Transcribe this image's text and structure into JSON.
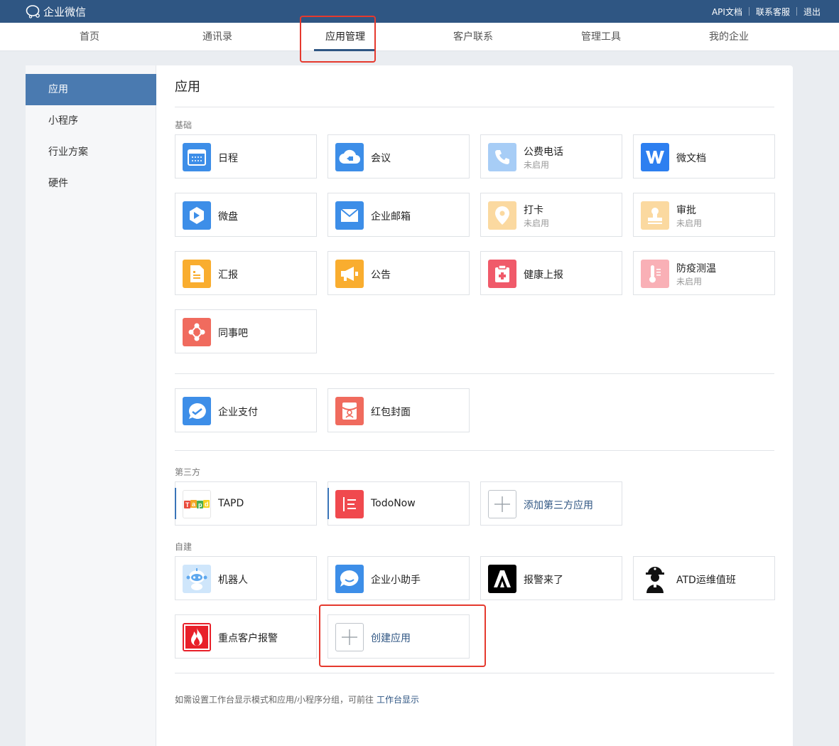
{
  "header": {
    "logo_text": "企业微信",
    "links": {
      "api": "API文档",
      "support": "联系客服",
      "logout": "退出"
    }
  },
  "nav": {
    "items": [
      "首页",
      "通讯录",
      "应用管理",
      "客户联系",
      "管理工具",
      "我的企业"
    ],
    "active_index": 2
  },
  "sidebar": {
    "items": [
      "应用",
      "小程序",
      "行业方案",
      "硬件"
    ],
    "active_index": 0
  },
  "main": {
    "title": "应用",
    "sections": {
      "basic": "基础",
      "third_party": "第三方",
      "custom": "自建"
    },
    "basic_apps": [
      {
        "name": "日程",
        "status": ""
      },
      {
        "name": "会议",
        "status": ""
      },
      {
        "name": "公费电话",
        "status": "未启用"
      },
      {
        "name": "微文档",
        "status": ""
      },
      {
        "name": "微盘",
        "status": ""
      },
      {
        "name": "企业邮箱",
        "status": ""
      },
      {
        "name": "打卡",
        "status": "未启用"
      },
      {
        "name": "审批",
        "status": "未启用"
      },
      {
        "name": "汇报",
        "status": ""
      },
      {
        "name": "公告",
        "status": ""
      },
      {
        "name": "健康上报",
        "status": ""
      },
      {
        "name": "防疫测温",
        "status": "未启用"
      },
      {
        "name": "同事吧",
        "status": ""
      }
    ],
    "payment_apps": [
      {
        "name": "企业支付"
      },
      {
        "name": "红包封面"
      }
    ],
    "third_party_apps": [
      {
        "name": "TAPD"
      },
      {
        "name": "TodoNow"
      }
    ],
    "add_third_party_label": "添加第三方应用",
    "custom_apps": [
      {
        "name": "机器人"
      },
      {
        "name": "企业小助手"
      },
      {
        "name": "报警来了"
      },
      {
        "name": "ATD运维值班"
      },
      {
        "name": "重点客户报警"
      }
    ],
    "create_app_label": "创建应用",
    "footer_note": "如需设置工作台显示模式和应用/小程序分组，可前往",
    "footer_link": "工作台显示"
  },
  "colors": {
    "header_bg": "#2f5683",
    "accent": "#2f5683",
    "sidebar_active": "#4a7ab0",
    "highlight_box": "#e5392e"
  }
}
